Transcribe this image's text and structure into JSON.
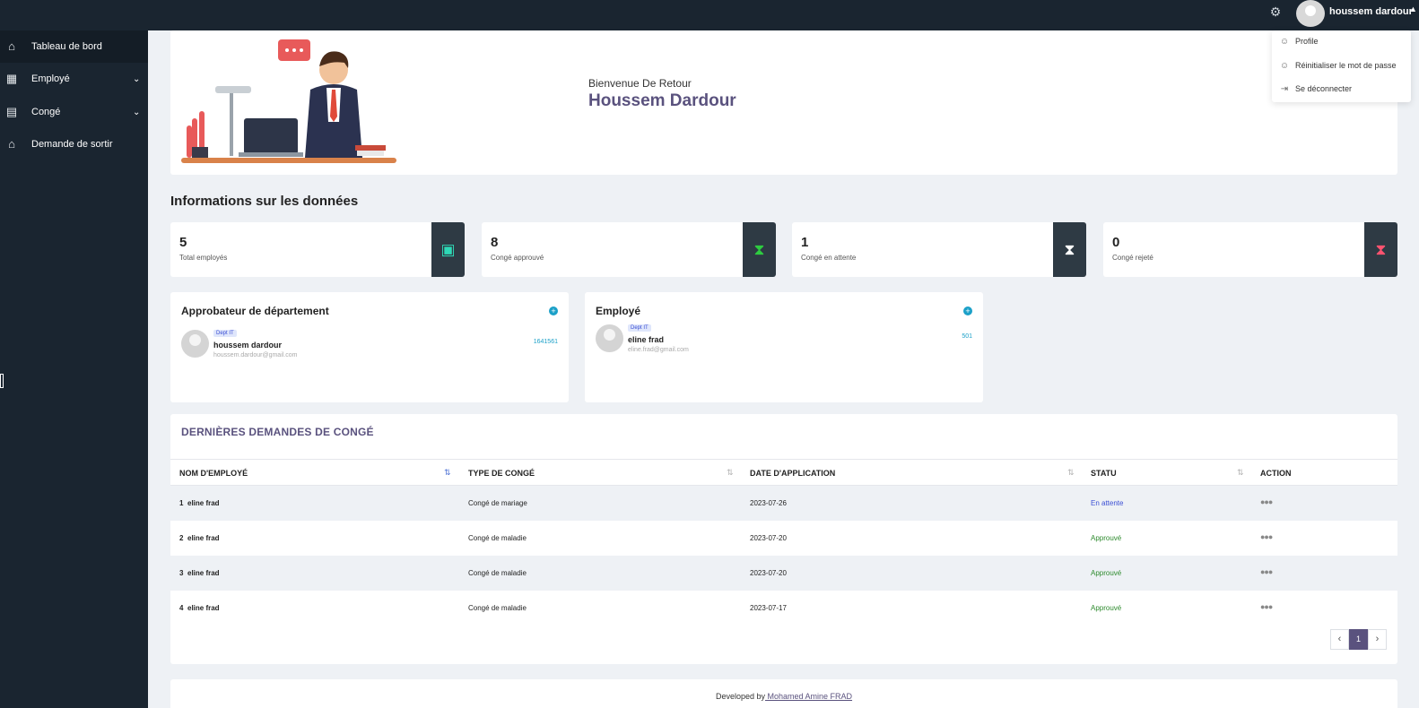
{
  "topbar": {
    "username": "houssem dardour",
    "settings_icon": "gear-icon"
  },
  "sidebar": {
    "items": [
      {
        "label": "Tableau de bord",
        "icon": "home-icon",
        "active": true
      },
      {
        "label": "Employé",
        "icon": "table-icon",
        "has_submenu": true
      },
      {
        "label": "Congé",
        "icon": "calculator-icon",
        "has_submenu": true
      },
      {
        "label": "Demande de sortir",
        "icon": "home-icon"
      }
    ]
  },
  "welcome": {
    "subtitle": "Bienvenue De Retour",
    "name": "Houssem Dardour"
  },
  "stats": {
    "title": "Informations sur les données",
    "cards": [
      {
        "value": "5",
        "label": "Total employés",
        "icon": "id-card-icon",
        "icon_color": "#2ed8b6"
      },
      {
        "value": "8",
        "label": "Congé approuvé",
        "icon": "hourglass-icon",
        "icon_color": "#2ecc40"
      },
      {
        "value": "1",
        "label": "Congé en attente",
        "icon": "hourglass-icon",
        "icon_color": "#ffffff"
      },
      {
        "value": "0",
        "label": "Congé rejeté",
        "icon": "hourglass-icon",
        "icon_color": "#ff5370"
      }
    ]
  },
  "approver_panel": {
    "title": "Approbateur de département",
    "person": {
      "tag": "Dept IT",
      "name": "houssem dardour",
      "email": "houssem.dardour@gmail.com",
      "id": "1641561"
    }
  },
  "employee_panel": {
    "title": "Employé",
    "person": {
      "tag": "Dept IT",
      "name": "eline frad",
      "email": "eline.frad@gmail.com",
      "id": "501"
    }
  },
  "leaves": {
    "title": "DERNIÈRES DEMANDES DE CONGÉ",
    "columns": [
      "NOM D'EMPLOYÉ",
      "TYPE DE CONGÉ",
      "DATE D'APPLICATION",
      "STATU",
      "ACTION"
    ],
    "rows": [
      {
        "num": "1",
        "name": "eline frad",
        "type": "Congé de mariage",
        "date": "2023-07-26",
        "status": "En attente"
      },
      {
        "num": "2",
        "name": "eline frad",
        "type": "Congé de maladie",
        "date": "2023-07-20",
        "status": "Approuvé"
      },
      {
        "num": "3",
        "name": "eline frad",
        "type": "Congé de maladie",
        "date": "2023-07-20",
        "status": "Approuvé"
      },
      {
        "num": "4",
        "name": "eline frad",
        "type": "Congé de maladie",
        "date": "2023-07-17",
        "status": "Approuvé"
      }
    ],
    "action_icon": "more-dots-icon",
    "pagination": {
      "prev": "‹",
      "current": "1",
      "next": "›"
    }
  },
  "footer": {
    "prefix": "Developed by",
    "author": " Mohamed Amine FRAD"
  },
  "user_menu": {
    "items": [
      {
        "label": "Profile",
        "icon": "user-icon"
      },
      {
        "label": "Réinitialiser le mot de passe",
        "icon": "user-icon"
      },
      {
        "label": "Se déconnecter",
        "icon": "logout-icon"
      }
    ]
  },
  "colors": {
    "sidebar": "#1a2530",
    "accent": "#5a527e",
    "pending": "#3b4fd4",
    "approved": "#2e8b2e"
  }
}
